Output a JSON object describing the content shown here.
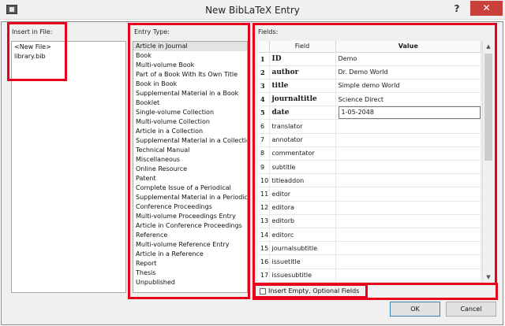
{
  "window": {
    "title": "New BibLaTeX Entry",
    "help_label": "?",
    "close_label": "✕",
    "app_icon": "app-icon"
  },
  "insert_in_file": {
    "label": "Insert in File:",
    "items": [
      "<New File>",
      "library.bib"
    ]
  },
  "entry_type": {
    "label": "Entry Type:",
    "selected_index": 0,
    "items": [
      "Article in Journal",
      "Book",
      "Multi-volume Book",
      "Part of a Book With Its Own Title",
      "Book in Book",
      "Supplemental Material in a Book",
      "Booklet",
      "Single-volume Collection",
      "Multi-volume Collection",
      "Article in a Collection",
      "Supplemental Material in a Collection",
      "Technical Manual",
      "Miscellaneous",
      "Online Resource",
      "Patent",
      "Complete Issue of a Periodical",
      "Supplemental Material in a Periodical",
      "Conference Proceedings",
      "Multi-volume Proceedings Entry",
      "Article in Conference Proceedings",
      "Reference",
      "Multi-volume Reference Entry",
      "Article in a Reference",
      "Report",
      "Thesis",
      "Unpublished"
    ]
  },
  "fields": {
    "label": "Fields:",
    "col_field": "Field",
    "col_value": "Value",
    "rows": [
      {
        "num": "1",
        "field": "ID",
        "value": "Demo",
        "required": true
      },
      {
        "num": "2",
        "field": "author",
        "value": "Dr. Demo World",
        "required": true
      },
      {
        "num": "3",
        "field": "title",
        "value": "Simple demo World",
        "required": true
      },
      {
        "num": "4",
        "field": "journaltitle",
        "value": "Science Direct",
        "required": true
      },
      {
        "num": "5",
        "field": "date",
        "value": "1-05-2048",
        "required": true,
        "editing": true
      },
      {
        "num": "6",
        "field": "translator",
        "value": ""
      },
      {
        "num": "7",
        "field": "annotator",
        "value": ""
      },
      {
        "num": "8",
        "field": "commentator",
        "value": ""
      },
      {
        "num": "9",
        "field": "subtitle",
        "value": ""
      },
      {
        "num": "10",
        "field": "titleaddon",
        "value": ""
      },
      {
        "num": "11",
        "field": "editor",
        "value": ""
      },
      {
        "num": "12",
        "field": "editora",
        "value": ""
      },
      {
        "num": "13",
        "field": "editorb",
        "value": ""
      },
      {
        "num": "14",
        "field": "editorc",
        "value": ""
      },
      {
        "num": "15",
        "field": "journalsubtitle",
        "value": ""
      },
      {
        "num": "16",
        "field": "issuetitle",
        "value": ""
      },
      {
        "num": "17",
        "field": "issuesubtitle",
        "value": ""
      }
    ]
  },
  "insert_empty": {
    "label": "Insert Empty, Optional Fields",
    "checked": false
  },
  "buttons": {
    "ok": "OK",
    "cancel": "Cancel"
  },
  "colors": {
    "highlight": "#e8001c",
    "close": "#c9403a",
    "selected_row": "#e3e3e3"
  }
}
